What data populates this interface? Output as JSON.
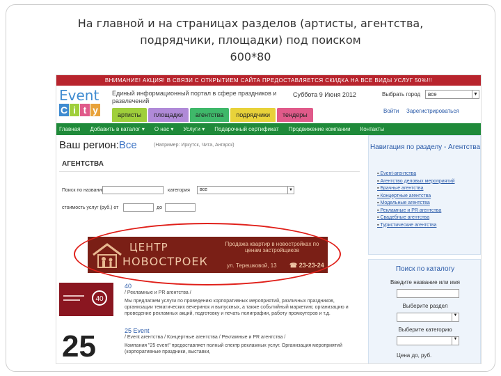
{
  "slide": {
    "title_line1": "На главной и на страницах разделов (артисты, агентства,",
    "title_line2": "подрядчики, площадки) под поиском",
    "title_line3": "600*80"
  },
  "site": {
    "banner": "ВНИМАНИЕ! АКЦИЯ! В СВЯЗИ С ОТКРЫТИЕМ САЙТА ПРЕДОСТАВЛЯЕТСЯ СКИДКА НА ВСЕ ВИДЫ УСЛУГ 50%!!!",
    "logo_event": "Event",
    "logo_city_letters": [
      "C",
      "i",
      "t",
      "y"
    ],
    "tagline": "Единый информационный портал в сфере праздников и развлечений",
    "date": "Суббота 9 Июня 2012",
    "city_label": "Выбрать город",
    "city_value": "все",
    "login": "Войти",
    "register": "Зарегистрироваться",
    "category_tabs": [
      {
        "label": "артисты",
        "color": "#9fcf3b"
      },
      {
        "label": "площадки",
        "color": "#b08ad8"
      },
      {
        "label": "агентства",
        "color": "#3fb86a"
      },
      {
        "label": "подрядчики",
        "color": "#e8d23a"
      },
      {
        "label": "тендеры",
        "color": "#e05a8a"
      }
    ],
    "nav_items": [
      "Главная",
      "Добавить в каталог ▾",
      "О нас ▾",
      "Услуги ▾",
      "Подарочный сертификат",
      "Продвижение компании",
      "Контакты"
    ]
  },
  "main": {
    "region_label": "Ваш регион:",
    "region_value": "Все",
    "region_hint": "(Например: Иркутск, Чита, Ангарск)",
    "section": "АГЕНТСТВА",
    "filter_name_label": "Поиск по названию:",
    "filter_category_label": "категория",
    "filter_category_value": "все",
    "filter_price_from_label": "стоимость услуг (руб.) от",
    "filter_price_to_label": "до"
  },
  "ad": {
    "brand_line1": "ЦЕНТР",
    "brand_line2": "НОВОСТРОЕК",
    "promo": "Продажа квартир в новостройках по ценам застройщиков",
    "address": "ул. Терешковой, 13",
    "phone": "☎ 23-23-24"
  },
  "listings": [
    {
      "name": "40",
      "categories": "/ Рекламные и PR агентства /",
      "description": "Мы предлагаем услуги по проведению корпоративных мероприятий, различных праздников, организации тематических вечеринок и выпускных, а также событийный маркетинг, организацию и проведение рекламных акций, подготовку и печать полиграфии, работу промоутеров и т.д."
    },
    {
      "name": "25 Event",
      "categories": "/ Event агентства / Концертные агентства / Рекламные и PR агентства /",
      "description": "Компания \"25 event\" предоставляет полный спектр рекламных услуг. Организация мероприятий (корпоративные праздники, выставки,"
    }
  ],
  "sidebar": {
    "nav_title": "Навигация по разделу - Агентства",
    "nav_items": [
      "Event-агентства",
      "Агентство деловых мероприятий",
      "Брачные агентства",
      "Концертные агентства",
      "Модельные агентства",
      "Рекламные и PR агентства",
      "Свадебные агентства",
      "Туристические агентства"
    ],
    "search_title": "Поиск по каталогу",
    "search_name_label": "Введите название или имя",
    "search_section_label": "Выберите раздел",
    "search_category_label": "Выберите категорию",
    "search_price_label": "Цена до, руб."
  },
  "colors": {
    "banner": "#b8242d",
    "nav": "#1f8a3a",
    "ad_bg": "#7a1f16",
    "highlight": "#e0201a",
    "link": "#2a5aa8"
  }
}
